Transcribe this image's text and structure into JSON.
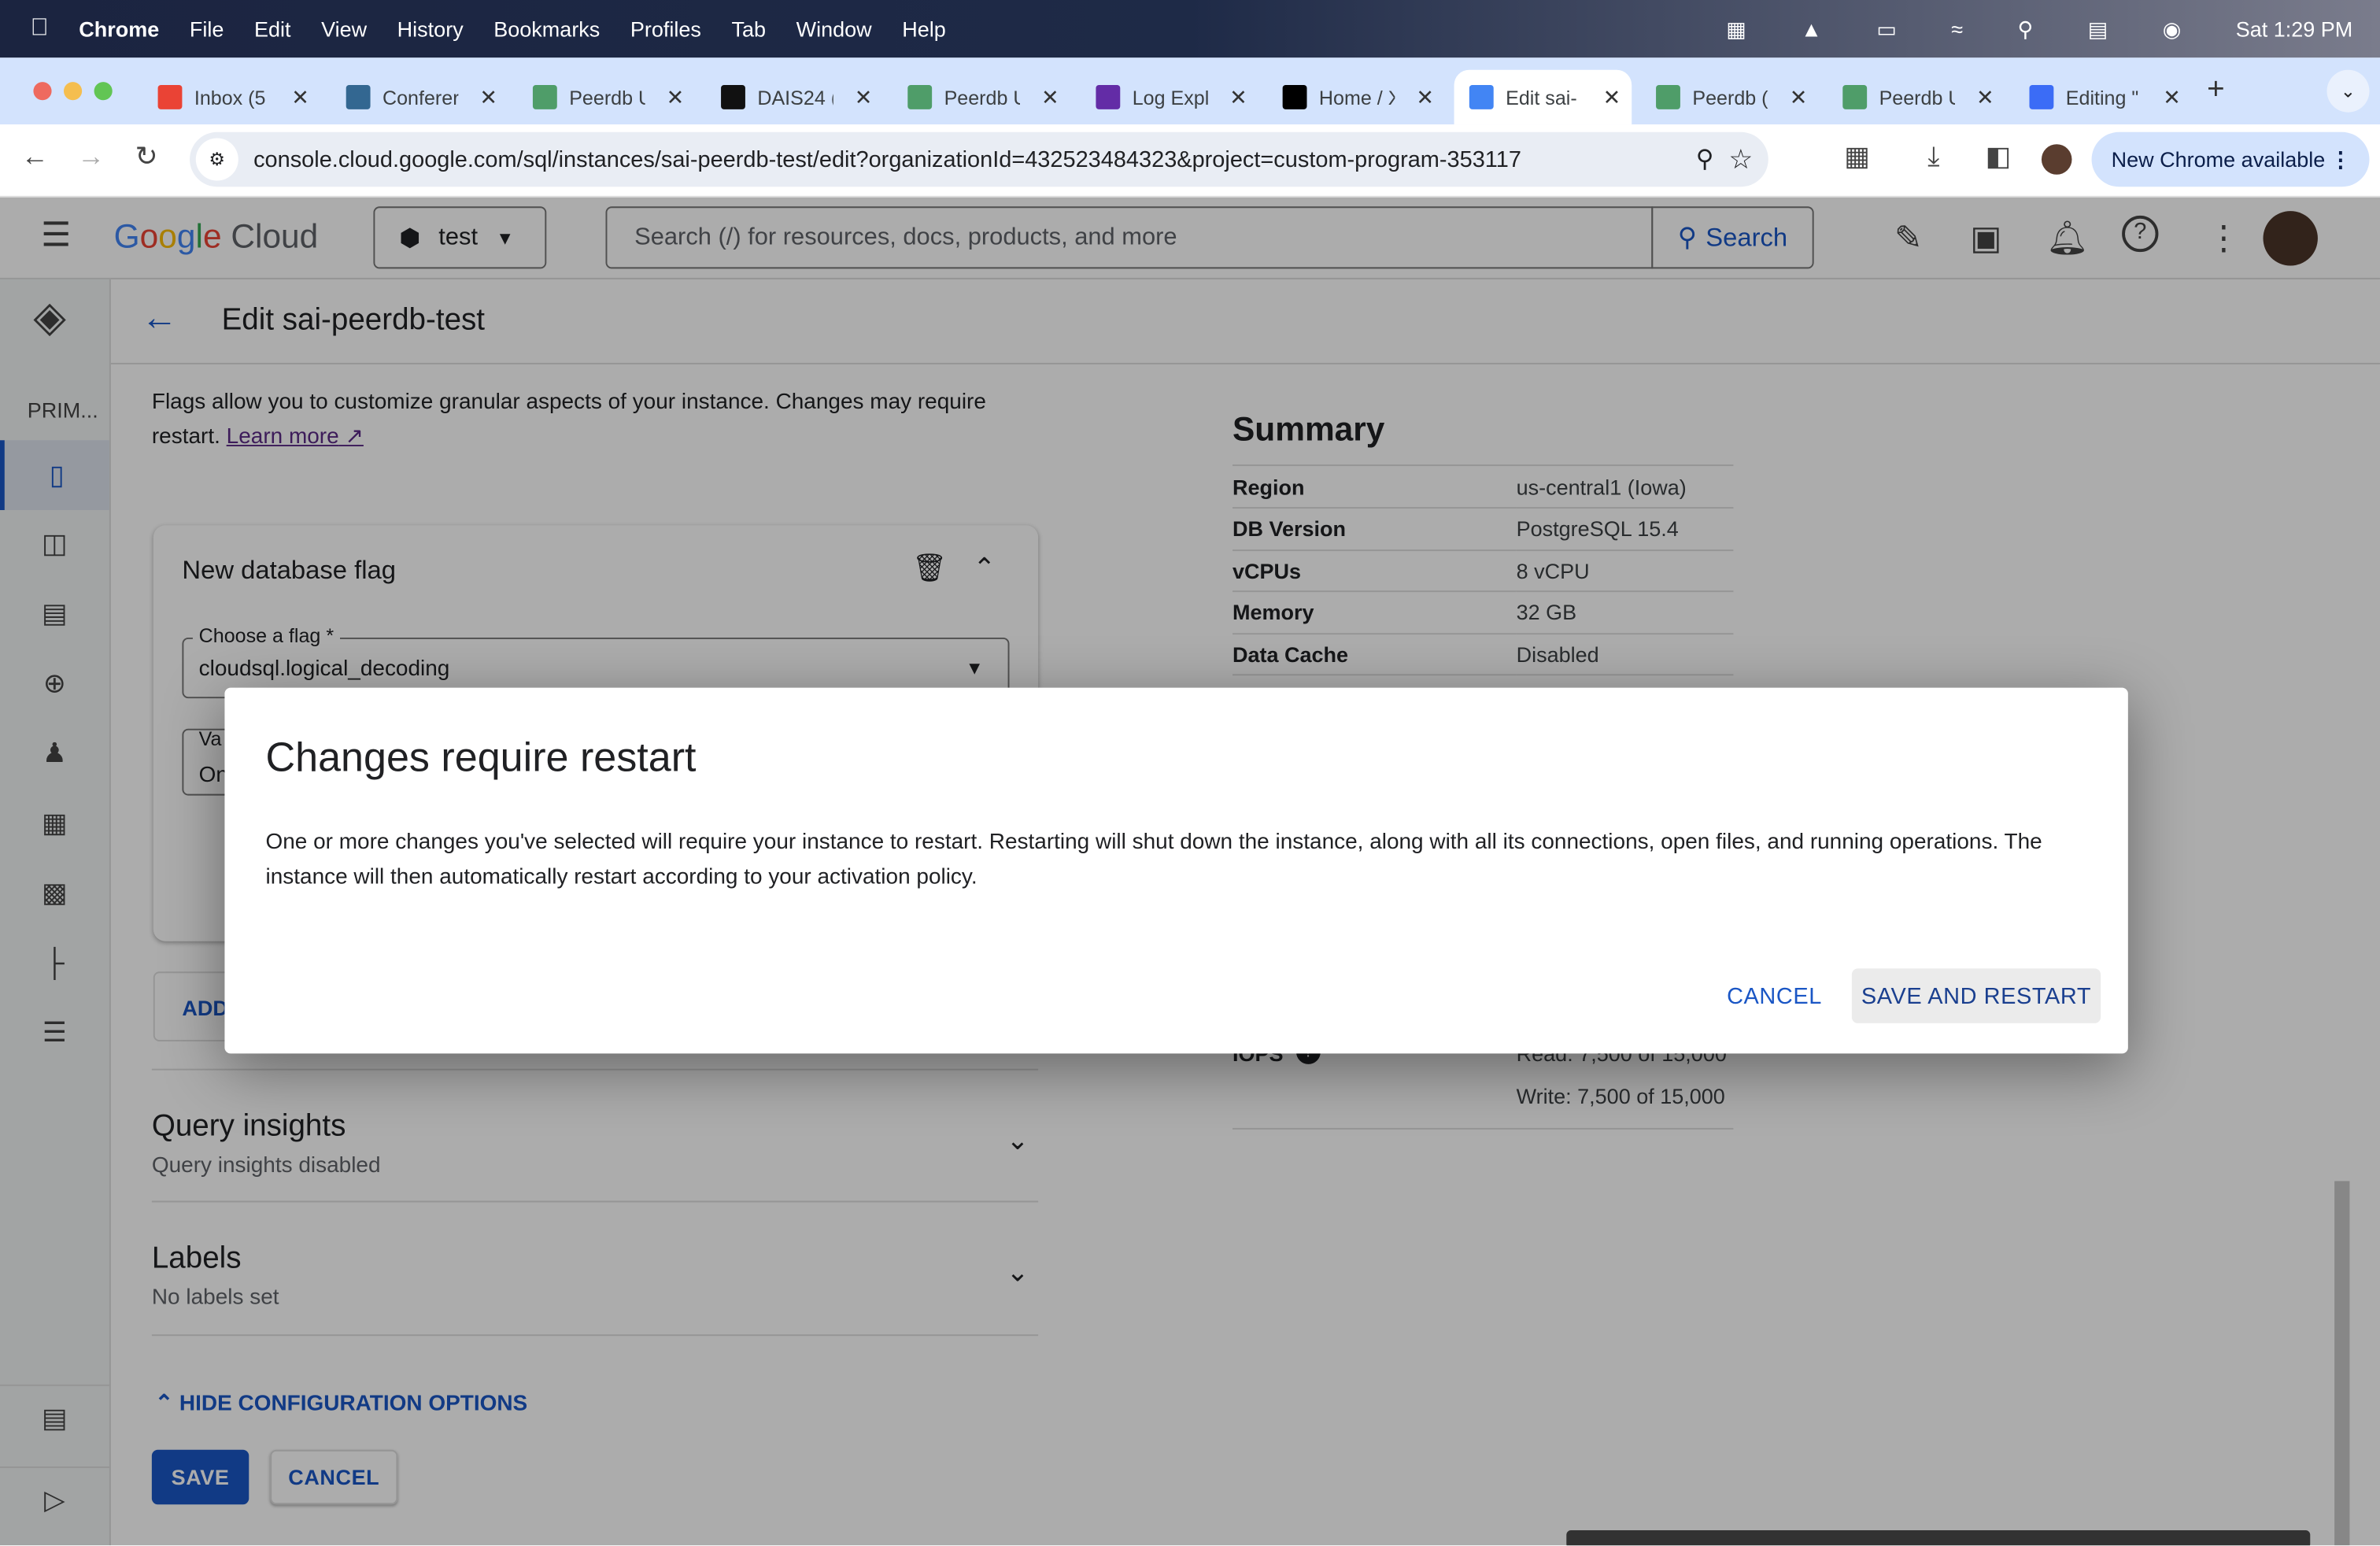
{
  "menubar": {
    "app": "Chrome",
    "items": [
      "File",
      "Edit",
      "View",
      "History",
      "Bookmarks",
      "Profiles",
      "Tab",
      "Window",
      "Help"
    ],
    "clock": "Sat 1:29 PM"
  },
  "tabs": [
    {
      "title": "Inbox (5",
      "favicon": "gmail-icon",
      "color": "#ea4335"
    },
    {
      "title": "Conferer",
      "favicon": "postgres-icon",
      "color": "#336791"
    },
    {
      "title": "Peerdb U",
      "favicon": "peerdb-icon",
      "color": "#4f9d69"
    },
    {
      "title": "DAIS24 (",
      "favicon": "dais-icon",
      "color": "#111111"
    },
    {
      "title": "Peerdb U",
      "favicon": "peerdb-icon",
      "color": "#4f9d69"
    },
    {
      "title": "Log Expl",
      "favicon": "datadog-icon",
      "color": "#632ca6"
    },
    {
      "title": "Home / X",
      "favicon": "x-icon",
      "color": "#000000"
    },
    {
      "title": "Edit sai-",
      "favicon": "cloudsql-icon",
      "color": "#4285f4",
      "active": true
    },
    {
      "title": "Peerdb (",
      "favicon": "peerdb-icon",
      "color": "#4f9d69"
    },
    {
      "title": "Peerdb U",
      "favicon": "peerdb-icon",
      "color": "#4f9d69"
    },
    {
      "title": "Editing \"",
      "favicon": "editor-icon",
      "color": "#3b6cf6"
    }
  ],
  "toolbar": {
    "url": "console.cloud.google.com/sql/instances/sai-peerdb-test/edit?organizationId=432523484323&project=custom-program-353117",
    "new_chrome": "New Chrome available"
  },
  "gcp": {
    "logo": "Google Cloud",
    "project": "test",
    "search_placeholder": "Search (/) for resources, docs, products, and more",
    "search_button": "Search",
    "sidenav_label": "PRIM...",
    "page_title": "Edit sai-peerdb-test",
    "flags_intro": "Flags allow you to customize granular aspects of your instance. Changes may require restart.",
    "learn_more": "Learn more",
    "flag_card_title": "New database flag",
    "choose_flag_label": "Choose a flag *",
    "choose_flag_value": "cloudsql.logical_decoding",
    "value_label": "Va",
    "value_value": "On",
    "add_flag": "ADD",
    "query_insights_title": "Query insights",
    "query_insights_sub": "Query insights disabled",
    "labels_title": "Labels",
    "labels_sub": "No labels set",
    "hide_config": "HIDE CONFIGURATION OPTIONS",
    "save": "SAVE",
    "cancel": "CANCEL",
    "summary": {
      "title": "Summary",
      "rows": [
        {
          "k": "Region",
          "v": "us-central1 (Iowa)"
        },
        {
          "k": "DB Version",
          "v": "PostgreSQL 15.4"
        },
        {
          "k": "vCPUs",
          "v": "8 vCPU"
        },
        {
          "k": "Memory",
          "v": "32 GB"
        },
        {
          "k": "Data Cache",
          "v": "Disabled"
        }
      ],
      "iops_label": "IOPS",
      "iops_read": "Read: 7,500 of 15,000",
      "iops_write": "Write: 7,500 of 15,000"
    }
  },
  "dialog": {
    "title": "Changes require restart",
    "body": "One or more changes you've selected will require your instance to restart. Restarting will shut down the instance, along with all its connections, open files, and running operations. The instance will then automatically restart according to your activation policy.",
    "cancel": "CANCEL",
    "confirm": "SAVE AND RESTART"
  },
  "colors": {
    "accent": "#1a73e8",
    "link": "#1a56c5",
    "scrim": "rgba(0,0,0,0.32)"
  }
}
